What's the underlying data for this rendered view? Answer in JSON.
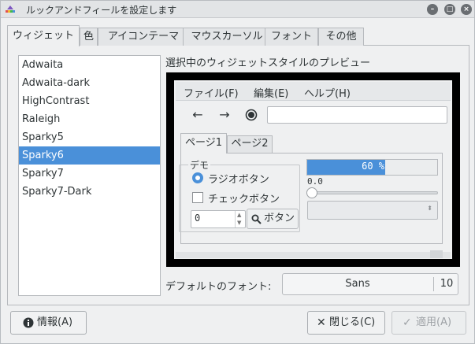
{
  "window": {
    "title": "ルックアンドフィールを設定します"
  },
  "tabs": [
    "ウィジェット",
    "色",
    "アイコンテーマ",
    "マウスカーソル",
    "フォント",
    "その他"
  ],
  "themes": {
    "items": [
      "Adwaita",
      "Adwaita-dark",
      "HighContrast",
      "Raleigh",
      "Sparky5",
      "Sparky6",
      "Sparky7",
      "Sparky7-Dark"
    ],
    "selected": "Sparky6"
  },
  "preview": {
    "label": "選択中のウィジェットスタイルのプレビュー",
    "menu": [
      "ファイル(F)",
      "編集(E)",
      "ヘルプ(H)"
    ],
    "tabs": [
      "ページ1",
      "ページ2"
    ],
    "demo_label": "デモ",
    "radio_label": "ラジオボタン",
    "check_label": "チェックボタン",
    "spin_value": "0",
    "button_label": "ボタン",
    "progress_text": "60 %",
    "progress_fraction": 0.6,
    "scale_value": "0.0"
  },
  "font": {
    "label": "デフォルトのフォント:",
    "name": "Sans",
    "size": "10"
  },
  "buttons": {
    "info": "情報(A)",
    "close": "閉じる(C)",
    "apply": "適用(A)"
  },
  "colors": {
    "accent": "#4a90d9"
  }
}
